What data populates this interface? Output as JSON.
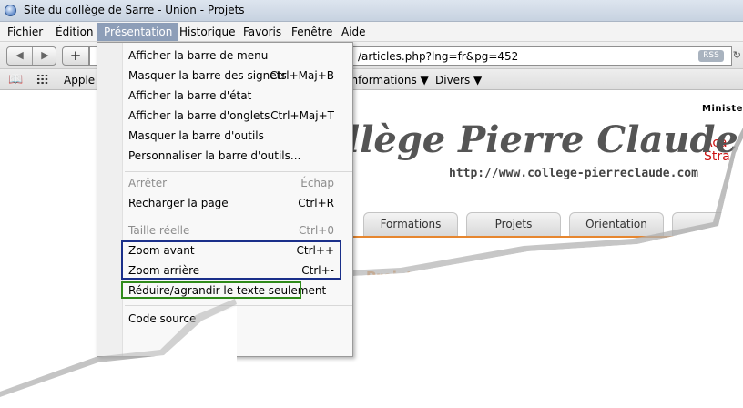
{
  "window": {
    "title": "Site du collège de Sarre - Union - Projets"
  },
  "menubar": {
    "items": [
      "Fichier",
      "Édition",
      "Présentation",
      "Historique",
      "Favoris",
      "Fenêtre",
      "Aide"
    ]
  },
  "toolbar": {
    "back_icon": "◀",
    "forward_icon": "▶",
    "add_icon": "+",
    "url": "/articles.php?lng=fr&pg=452",
    "rss": "RSS"
  },
  "bookmarks": {
    "items": [
      "Apple",
      "Informations ▼",
      "Divers ▼"
    ]
  },
  "page": {
    "ministere": "Ministere",
    "aca": [
      "Aca",
      "Stra"
    ],
    "site_title": "llège Pierre Claude",
    "site_url": "http://www.college-pierreclaude.com",
    "tabs": [
      "Formations",
      "Projets",
      "Orientation"
    ],
    "section": "Projets"
  },
  "menu": {
    "items": [
      {
        "label": "Afficher la barre de menu",
        "shortcut": ""
      },
      {
        "label": "Masquer la barre des signets",
        "shortcut": "Ctrl+Maj+B"
      },
      {
        "label": "Afficher la barre d'état",
        "shortcut": ""
      },
      {
        "label": "Afficher la barre d'onglets",
        "shortcut": "Ctrl+Maj+T"
      },
      {
        "label": "Masquer la barre d'outils",
        "shortcut": ""
      },
      {
        "label": "Personnaliser la barre d'outils...",
        "shortcut": ""
      },
      {
        "label": "Arrêter",
        "shortcut": "Échap"
      },
      {
        "label": "Recharger la page",
        "shortcut": "Ctrl+R"
      },
      {
        "label": "Taille réelle",
        "shortcut": "Ctrl+0"
      },
      {
        "label": "Zoom avant",
        "shortcut": "Ctrl++"
      },
      {
        "label": "Zoom arrière",
        "shortcut": "Ctrl+-"
      },
      {
        "label": "Réduire/agrandir le texte seulement",
        "shortcut": ""
      },
      {
        "label": "Code source",
        "shortcut": ""
      }
    ]
  },
  "colors": {
    "accent": "#e6862f",
    "menu_active": "#8d9eb8",
    "highlight_blue": "#1a2f8a",
    "highlight_green": "#2f8a1a"
  }
}
